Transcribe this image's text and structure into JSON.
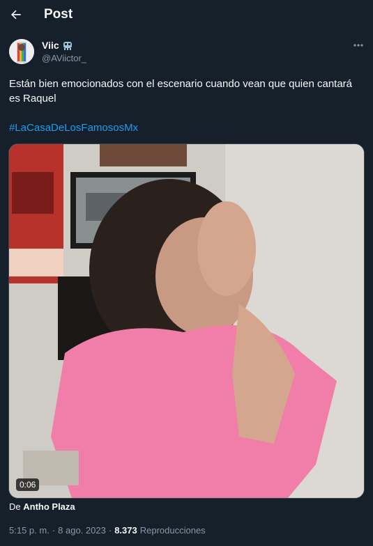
{
  "header": {
    "title": "Post",
    "back_icon": "arrow-left-icon"
  },
  "author": {
    "display_name": "Viic",
    "emoji_icon": "alien-monster-icon",
    "handle": "@AViictor_"
  },
  "tweet": {
    "text": "Están bien emocionados con el escenario cuando vean que quien cantará es Raquel",
    "hashtag": "#LaCasaDeLosFamososMx"
  },
  "media": {
    "type": "video",
    "duration": "0:06"
  },
  "source": {
    "prefix": "De",
    "name": "Antho Plaza"
  },
  "meta": {
    "time": "5:15 p. m.",
    "dot1": "·",
    "date": "8 ago. 2023",
    "dot2": "·",
    "views": "8.373",
    "views_label": "Reproducciones"
  },
  "colors": {
    "background": "#15202b",
    "text": "#f7f9f9",
    "secondary": "#8b98a5",
    "link": "#1d9bf0",
    "border": "#38444d"
  }
}
